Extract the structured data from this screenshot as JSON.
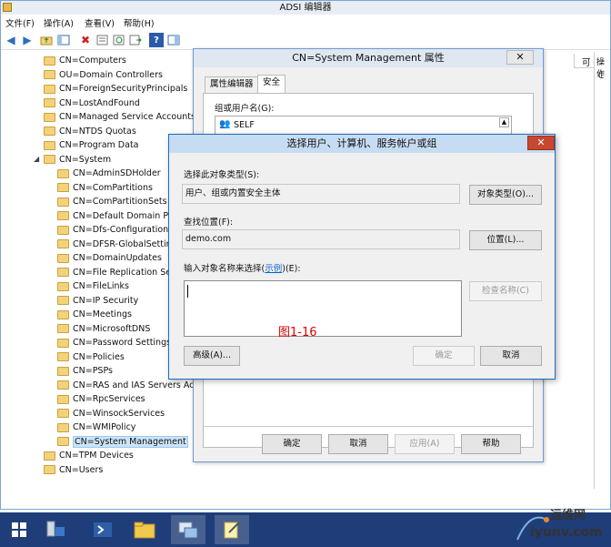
{
  "window": {
    "title": "ADSI 编辑器"
  },
  "menu": {
    "file": "文件(F)",
    "action": "操作(A)",
    "view": "查看(V)",
    "help": "帮助(H)"
  },
  "right_column": {
    "header": "可",
    "side_label": "操作",
    "side_value": "C"
  },
  "tree": {
    "items": [
      "CN=Computers",
      "OU=Domain Controllers",
      "CN=ForeignSecurityPrincipals",
      "CN=LostAndFound",
      "CN=Managed Service Accounts",
      "CN=NTDS Quotas",
      "CN=Program Data",
      "CN=System",
      "CN=AdminSDHolder",
      "CN=ComPartitions",
      "CN=ComPartitionSets",
      "CN=Default Domain Po",
      "CN=Dfs-Configuration",
      "CN=DFSR-GlobalSetting",
      "CN=DomainUpdates",
      "CN=File Replication Ser",
      "CN=FileLinks",
      "CN=IP Security",
      "CN=Meetings",
      "CN=MicrosoftDNS",
      "CN=Password Settings",
      "CN=Policies",
      "CN=PSPs",
      "CN=RAS and IAS Servers Acc",
      "CN=RpcServices",
      "CN=WinsockServices",
      "CN=WMIPolicy",
      "CN=System Management",
      "CN=TPM Devices",
      "CN=Users"
    ]
  },
  "props_dialog": {
    "title": "CN=System Management 属性",
    "tabs": [
      "属性编辑器",
      "安全"
    ],
    "group_label": "组或用户名(G):",
    "self_entry": "SELF",
    "ok": "确定",
    "cancel": "取消",
    "apply": "应用(A)",
    "help": "帮助"
  },
  "select_dialog": {
    "title": "选择用户、计算机、服务帐户或组",
    "object_type_label": "选择此对象类型(S):",
    "object_type_value": "用户、组或内置安全主体",
    "object_type_button": "对象类型(O)...",
    "location_label": "查找位置(F):",
    "location_value": "demo.com",
    "location_button": "位置(L)...",
    "names_label_prefix": "输入对象名称来选择(",
    "names_label_link": "示例",
    "names_label_suffix": ")(E):",
    "check_names_button": "检查名称(C)",
    "advanced_button": "高级(A)...",
    "ok": "确定",
    "cancel": "取消",
    "figure_label": "图1-16"
  },
  "watermark": {
    "site": "运维网",
    "url": "iyunv.com"
  }
}
